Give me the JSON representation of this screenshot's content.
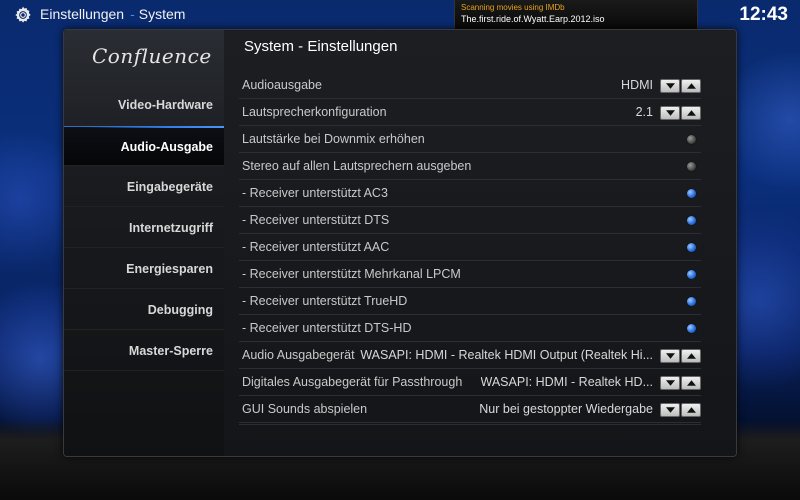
{
  "header": {
    "app_title": "Einstellungen",
    "separator": "-",
    "section": "System",
    "clock": "12:43"
  },
  "notification": {
    "title": "Scanning movies using IMDb",
    "text": "The.first.ride.of.Wyatt.Earp.2012.iso",
    "progress": 0.9
  },
  "sidebar": {
    "logo": "Confluence",
    "items": [
      {
        "label": "Video-Hardware"
      },
      {
        "label": "Audio-Ausgabe",
        "active": true
      },
      {
        "label": "Eingabegeräte"
      },
      {
        "label": "Internetzugriff"
      },
      {
        "label": "Energiesparen"
      },
      {
        "label": "Debugging"
      },
      {
        "label": "Master-Sperre"
      }
    ]
  },
  "content": {
    "title": "System - Einstellungen",
    "rows": [
      {
        "label": "Audioausgabe",
        "value": "HDMI",
        "type": "spinner"
      },
      {
        "label": "Lautsprecherkonfiguration",
        "value": "2.1",
        "type": "spinner"
      },
      {
        "label": "Lautstärke bei Downmix erhöhen",
        "type": "toggle",
        "on": false
      },
      {
        "label": "Stereo auf allen Lautsprechern ausgeben",
        "type": "toggle",
        "on": false
      },
      {
        "label": "- Receiver unterstützt AC3",
        "type": "toggle",
        "on": true
      },
      {
        "label": "- Receiver unterstützt DTS",
        "type": "toggle",
        "on": true
      },
      {
        "label": "- Receiver unterstützt AAC",
        "type": "toggle",
        "on": true
      },
      {
        "label": "- Receiver unterstützt Mehrkanal LPCM",
        "type": "toggle",
        "on": true
      },
      {
        "label": "- Receiver unterstützt TrueHD",
        "type": "toggle",
        "on": true
      },
      {
        "label": "- Receiver unterstützt DTS-HD",
        "type": "toggle",
        "on": true
      },
      {
        "label": "Audio Ausgabegerät",
        "value": "WASAPI: HDMI - Realtek HDMI Output (Realtek Hi...",
        "type": "spinner"
      },
      {
        "label": "Digitales Ausgabegerät für Passthrough",
        "value": "WASAPI: HDMI - Realtek HD...",
        "type": "spinner"
      },
      {
        "label": "GUI Sounds abspielen",
        "value": "Nur bei gestoppter Wiedergabe",
        "type": "spinner"
      }
    ]
  },
  "colors": {
    "accent": "#2f7fe8",
    "notification_title": "#e8a21c",
    "toggle_on": "#2a6fe0",
    "toggle_off": "#3b3b3b"
  }
}
